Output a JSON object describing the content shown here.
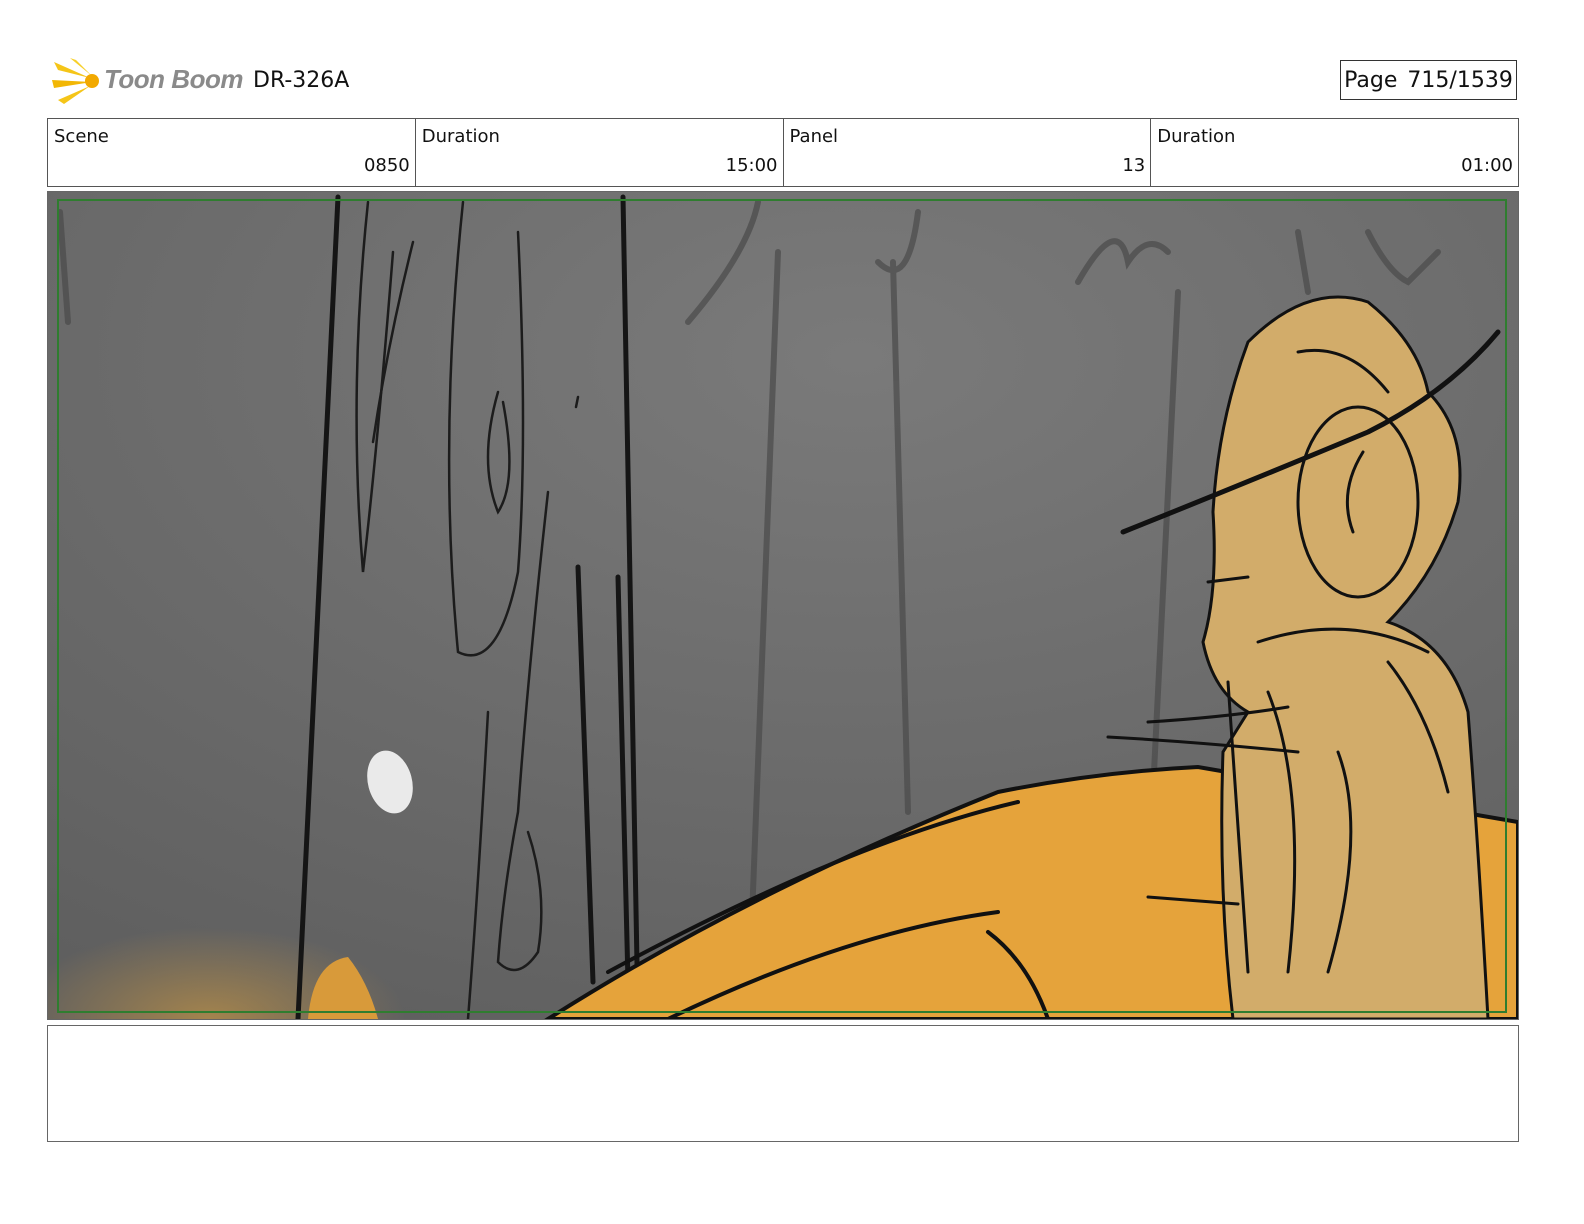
{
  "header": {
    "logo_text": "Toon Boom",
    "production_code": "DR-326A",
    "page_label": "Page",
    "page_number": "715/1539"
  },
  "meta": {
    "scene_label": "Scene",
    "scene_value": "0850",
    "scene_duration_label": "Duration",
    "scene_duration_value": "15:00",
    "panel_label": "Panel",
    "panel_value": "13",
    "panel_duration_label": "Duration",
    "panel_duration_value": "01:00"
  },
  "notes": {
    "text": ""
  },
  "colors": {
    "safe_frame": "#2f7d2f",
    "background_gray": "#6e6e6e",
    "character_tan": "#d2ac6a",
    "vehicle_orange": "#e5a33b",
    "logo_accent": "#f2c21a"
  }
}
